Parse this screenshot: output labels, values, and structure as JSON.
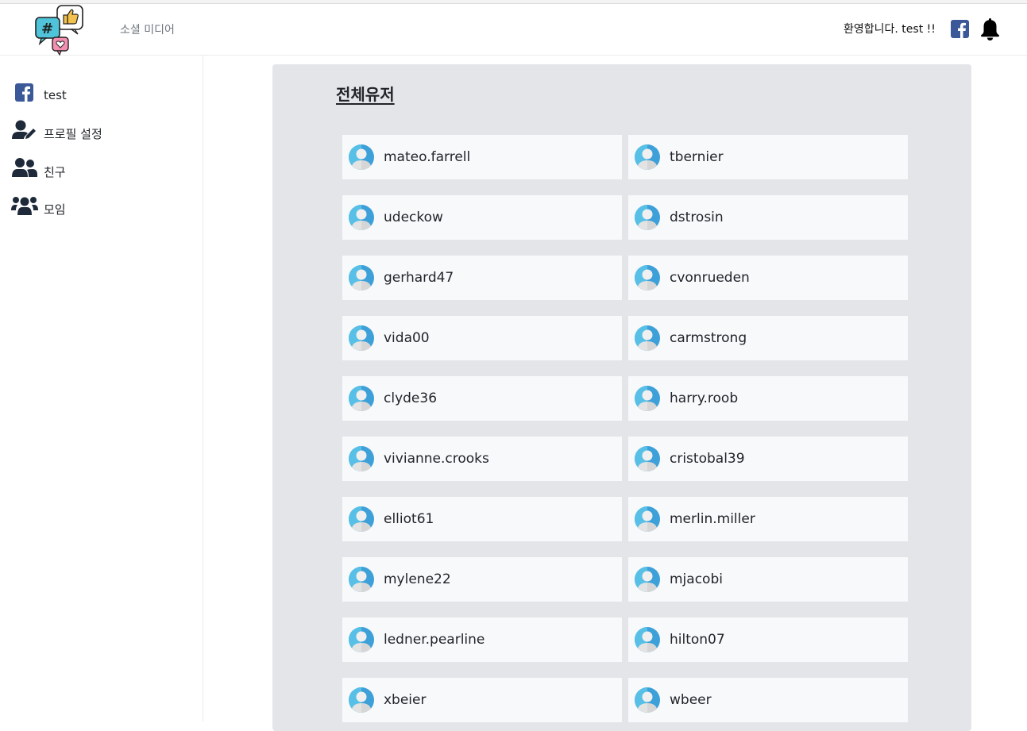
{
  "header": {
    "brand": "소셜 미디어",
    "welcome": "환영합니다. test !!",
    "logo_icon": "social-bubbles-logo",
    "facebook_icon": "facebook-icon",
    "bell_icon": "bell-icon"
  },
  "sidebar": {
    "items": [
      {
        "label": "test",
        "icon": "facebook-icon"
      },
      {
        "label": "프로필 설정",
        "icon": "user-edit-icon"
      },
      {
        "label": "친구",
        "icon": "user-friends-icon"
      },
      {
        "label": "모임",
        "icon": "users-group-icon"
      }
    ]
  },
  "main": {
    "title": "전체유저",
    "users": [
      "mateo.farrell",
      "tbernier",
      "udeckow",
      "dstrosin",
      "gerhard47",
      "cvonrueden",
      "vida00",
      "carmstrong",
      "clyde36",
      "harry.roob",
      "vivianne.crooks",
      "cristobal39",
      "elliot61",
      "merlin.miller",
      "mylene22",
      "mjacobi",
      "ledner.pearline",
      "hilton07",
      "xbeier",
      "wbeer"
    ]
  },
  "colors": {
    "facebook_blue": "#3b5998",
    "panel_bg": "#e4e5e8",
    "card_bg": "#f8f9fb",
    "avatar_blue": "#3ea0d8"
  }
}
